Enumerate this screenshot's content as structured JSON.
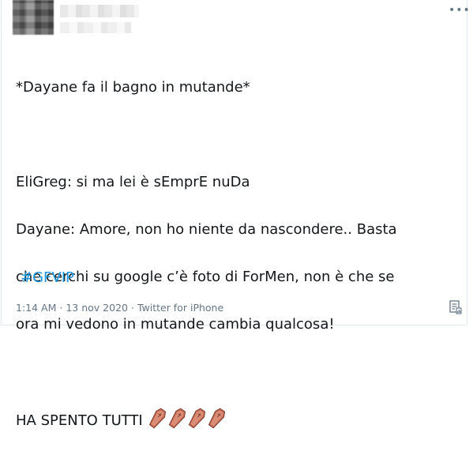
{
  "tweet": {
    "lines": [
      "*Dayane fa il bagno in mutande*",
      "EliGreg: si ma lei è sEmprE nuDa",
      "Dayane: Amore, non ho niente da nascondere.. Basta",
      "che cerchi su google c’è foto di ForMen, non è che se",
      "ora mi vedono in mutande cambia qualcosa!",
      "HA SPENTO TUTTI"
    ],
    "emoji": [
      "coffin-icon",
      "coffin-icon",
      "coffin-icon",
      "coffin-icon"
    ],
    "hashtag": "#GFVIP",
    "time": "1:14 AM",
    "date": "13 nov 2020",
    "source": "Twitter for iPhone",
    "separator": "·"
  },
  "colors": {
    "text": "#14171a",
    "secondary": "#657786",
    "link": "#1b95e0",
    "coffin": "#c96b55"
  }
}
